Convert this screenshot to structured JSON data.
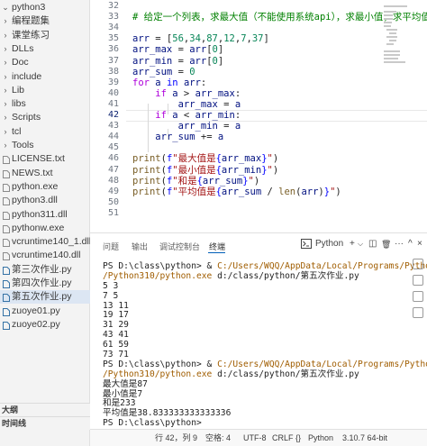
{
  "explorer": {
    "items": [
      {
        "label": "python3",
        "kind": "folder",
        "open": true
      },
      {
        "label": "编程题集",
        "kind": "folder"
      },
      {
        "label": "课堂练习",
        "kind": "folder"
      },
      {
        "label": "DLLs",
        "kind": "folder"
      },
      {
        "label": "Doc",
        "kind": "folder"
      },
      {
        "label": "include",
        "kind": "folder"
      },
      {
        "label": "Lib",
        "kind": "folder"
      },
      {
        "label": "libs",
        "kind": "folder"
      },
      {
        "label": "Scripts",
        "kind": "folder"
      },
      {
        "label": "tcl",
        "kind": "folder"
      },
      {
        "label": "Tools",
        "kind": "folder"
      },
      {
        "label": "LICENSE.txt",
        "kind": "file"
      },
      {
        "label": "NEWS.txt",
        "kind": "file"
      },
      {
        "label": "python.exe",
        "kind": "file"
      },
      {
        "label": "python3.dll",
        "kind": "file"
      },
      {
        "label": "python311.dll",
        "kind": "file"
      },
      {
        "label": "pythonw.exe",
        "kind": "file"
      },
      {
        "label": "vcruntime140_1.dll",
        "kind": "file"
      },
      {
        "label": "vcruntime140.dll",
        "kind": "file"
      },
      {
        "label": "第三次作业.py",
        "kind": "py"
      },
      {
        "label": "第四次作业.py",
        "kind": "py"
      },
      {
        "label": "第五次作业.py",
        "kind": "py",
        "selected": true
      },
      {
        "label": "zuoye01.py",
        "kind": "py"
      },
      {
        "label": "zuoye02.py",
        "kind": "py"
      }
    ],
    "outline_label": "大纲",
    "timeline_label": "时间线"
  },
  "editor": {
    "lines": [
      {
        "num": "32",
        "html": ""
      },
      {
        "num": "33",
        "html": "<span class=\"c\"># 给定一个列表，求最大值（不能使用系统api），求最小值，求平均值，求和</span>"
      },
      {
        "num": "34",
        "html": ""
      },
      {
        "num": "35",
        "html": "<span class=\"v\">arr</span> = [<span class=\"n\">56</span>,<span class=\"n\">34</span>,<span class=\"n\">87</span>,<span class=\"n\">12</span>,<span class=\"n\">7</span>,<span class=\"n\">37</span>]"
      },
      {
        "num": "36",
        "html": "<span class=\"v\">arr_max</span> = <span class=\"v\">arr</span>[<span class=\"n\">0</span>]"
      },
      {
        "num": "37",
        "html": "<span class=\"v\">arr_min</span> = <span class=\"v\">arr</span>[<span class=\"n\">0</span>]"
      },
      {
        "num": "38",
        "html": "<span class=\"v\">arr_sum</span> = <span class=\"n\">0</span>"
      },
      {
        "num": "39",
        "html": "<span class=\"k\">for</span> <span class=\"v\">a</span> <span class=\"kb\">in</span> <span class=\"v\">arr</span>:"
      },
      {
        "num": "40",
        "html": "    <span class=\"k\">if</span> <span class=\"v\">a</span> &gt; <span class=\"v\">arr_max</span>:"
      },
      {
        "num": "41",
        "html": "        <span class=\"v\">arr_max</span> = <span class=\"v\">a</span>"
      },
      {
        "num": "42",
        "html": "    <span class=\"k\">if</span> <span class=\"v\">a</span> &lt; <span class=\"v\">arr_min</span>:",
        "active": true
      },
      {
        "num": "43",
        "html": "        <span class=\"v\">arr_min</span> = <span class=\"v\">a</span>"
      },
      {
        "num": "44",
        "html": "    <span class=\"v\">arr_sum</span> += <span class=\"v\">a</span>"
      },
      {
        "num": "45",
        "html": ""
      },
      {
        "num": "46",
        "html": "<span class=\"f\">print</span>(<span class=\"kb\">f</span><span class=\"s\">\"最大值是</span><span class=\"kb\">{</span><span class=\"v\">arr_max</span><span class=\"kb\">}</span><span class=\"s\">\"</span>)"
      },
      {
        "num": "47",
        "html": "<span class=\"f\">print</span>(<span class=\"kb\">f</span><span class=\"s\">\"最小值是</span><span class=\"kb\">{</span><span class=\"v\">arr_min</span><span class=\"kb\">}</span><span class=\"s\">\"</span>)"
      },
      {
        "num": "48",
        "html": "<span class=\"f\">print</span>(<span class=\"kb\">f</span><span class=\"s\">\"和是</span><span class=\"kb\">{</span><span class=\"v\">arr_sum</span><span class=\"kb\">}</span><span class=\"s\">\"</span>)"
      },
      {
        "num": "49",
        "html": "<span class=\"f\">print</span>(<span class=\"kb\">f</span><span class=\"s\">\"平均值是</span><span class=\"kb\">{</span><span class=\"v\">arr_sum</span> / <span class=\"f\">len</span>(<span class=\"v\">arr</span>)<span class=\"kb\">}</span><span class=\"s\">\"</span>)"
      },
      {
        "num": "50",
        "html": ""
      },
      {
        "num": "51",
        "html": ""
      }
    ]
  },
  "panel": {
    "tabs": [
      "问题",
      "输出",
      "调试控制台",
      "终端"
    ],
    "active_tab": "终端",
    "terminal_name": "Python",
    "add_glyph": "+",
    "dropdown_glyph": "⌵",
    "split_glyph": "◫",
    "trash_glyph": "🗑",
    "more_glyph": "···",
    "max_glyph": "^",
    "close_glyph": "×",
    "terminal_lines": [
      [
        {
          "t": "PS D:\\class\\python> & "
        },
        {
          "t": "C:/Users/WQQ/AppData/Local/Programs/Python",
          "y": true
        }
      ],
      [
        {
          "t": "/Python310/python.exe",
          "y": true
        },
        {
          "t": " d:/class/python/第五次作业.py"
        }
      ],
      [
        {
          "t": "5 3"
        }
      ],
      [
        {
          "t": "7 5"
        }
      ],
      [
        {
          "t": "13 11"
        }
      ],
      [
        {
          "t": "19 17"
        }
      ],
      [
        {
          "t": "31 29"
        }
      ],
      [
        {
          "t": "43 41"
        }
      ],
      [
        {
          "t": "61 59"
        }
      ],
      [
        {
          "t": "73 71"
        }
      ],
      [
        {
          "t": "PS D:\\class\\python> & "
        },
        {
          "t": "C:/Users/WQQ/AppData/Local/Programs/Python",
          "y": true
        }
      ],
      [
        {
          "t": "/Python310/python.exe",
          "y": true
        },
        {
          "t": " d:/class/python/第五次作业.py"
        }
      ],
      [
        {
          "t": "最大值是87"
        }
      ],
      [
        {
          "t": "最小值是7"
        }
      ],
      [
        {
          "t": "和是233"
        }
      ],
      [
        {
          "t": "平均值是38.833333333333336"
        }
      ],
      [
        {
          "t": "PS D:\\class\\python> "
        }
      ]
    ]
  },
  "statusbar": {
    "position": "行 42，列 9",
    "spaces": "空格: 4",
    "encoding": "UTF-8",
    "eol": "CRLF",
    "braces": "{}",
    "language": "Python",
    "interpreter": "3.10.7 64-bit"
  }
}
